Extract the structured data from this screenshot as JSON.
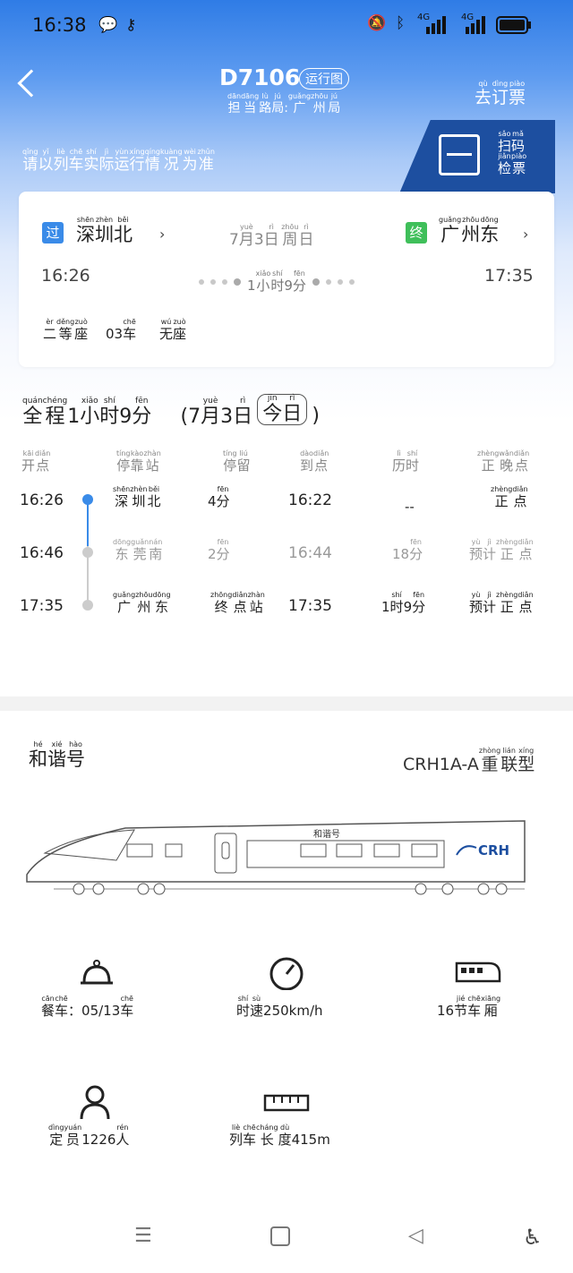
{
  "status_bar": {
    "time": "16:38",
    "network": "4G"
  },
  "header": {
    "train_no": "D7106",
    "timetable_tag": "运行图",
    "bureau": [
      {
        "hz": "担",
        "py": "dān"
      },
      {
        "hz": "当",
        "py": "dāng"
      },
      {
        "hz": "路",
        "py": "lù"
      },
      {
        "hz": "局",
        "py": "jú"
      },
      {
        "hz": ":",
        "py": ""
      },
      {
        "hz": "广",
        "py": "guǎng"
      },
      {
        "hz": "州",
        "py": "zhōu"
      },
      {
        "hz": "局",
        "py": "jú"
      }
    ],
    "buy_ticket": [
      {
        "hz": "去",
        "py": "qù"
      },
      {
        "hz": "订",
        "py": "dìng"
      },
      {
        "hz": "票",
        "py": "piào"
      }
    ],
    "banner_note": [
      {
        "hz": "请",
        "py": "qǐng"
      },
      {
        "hz": "以",
        "py": "yǐ"
      },
      {
        "hz": "列",
        "py": "liè"
      },
      {
        "hz": "车",
        "py": "chē"
      },
      {
        "hz": "实",
        "py": "shí"
      },
      {
        "hz": "际",
        "py": "jì"
      },
      {
        "hz": "运",
        "py": "yùn"
      },
      {
        "hz": "行",
        "py": "xíng"
      },
      {
        "hz": "情",
        "py": "qíng"
      },
      {
        "hz": "况",
        "py": "kuàng"
      },
      {
        "hz": "为",
        "py": "wèi"
      },
      {
        "hz": "准",
        "py": "zhǔn"
      }
    ],
    "scan_check": [
      [
        {
          "hz": "扫",
          "py": "sǎo"
        },
        {
          "hz": "码",
          "py": "mǎ"
        }
      ],
      [
        {
          "hz": "检",
          "py": "jiǎn"
        },
        {
          "hz": "票",
          "py": "piào"
        }
      ]
    ]
  },
  "trip_card": {
    "from_tag": "过",
    "from_station": [
      {
        "hz": "深",
        "py": "shēn"
      },
      {
        "hz": "圳",
        "py": "zhèn"
      },
      {
        "hz": "北",
        "py": "běi"
      }
    ],
    "to_tag": "终",
    "to_station": [
      {
        "hz": "广",
        "py": "guǎng"
      },
      {
        "hz": "州",
        "py": "zhōu"
      },
      {
        "hz": "东",
        "py": "dōng"
      }
    ],
    "date": [
      {
        "hz": "7",
        "py": ""
      },
      {
        "hz": "月",
        "py": "yuè"
      },
      {
        "hz": "3",
        "py": ""
      },
      {
        "hz": "日",
        "py": "rì"
      },
      {
        "hz": " ",
        "py": ""
      },
      {
        "hz": "周",
        "py": "zhōu"
      },
      {
        "hz": "日",
        "py": "rì"
      }
    ],
    "depart_time": "16:26",
    "arrive_time": "17:35",
    "duration": [
      {
        "hz": "1",
        "py": ""
      },
      {
        "hz": "小",
        "py": "xiǎo"
      },
      {
        "hz": "时",
        "py": "shí"
      },
      {
        "hz": "9",
        "py": ""
      },
      {
        "hz": "分",
        "py": "fēn"
      }
    ],
    "seat_class": [
      {
        "hz": "二",
        "py": "èr"
      },
      {
        "hz": "等",
        "py": "děng"
      },
      {
        "hz": "座",
        "py": "zuò"
      }
    ],
    "car": [
      {
        "hz": "03",
        "py": ""
      },
      {
        "hz": "车",
        "py": "chē"
      }
    ],
    "seat": [
      {
        "hz": "无",
        "py": "wú"
      },
      {
        "hz": "座",
        "py": "zuò"
      }
    ]
  },
  "total": {
    "label": [
      {
        "hz": "全",
        "py": "quán"
      },
      {
        "hz": "程",
        "py": "chéng"
      },
      {
        "hz": "1",
        "py": ""
      },
      {
        "hz": "小",
        "py": "xiǎo"
      },
      {
        "hz": "时",
        "py": "shí"
      },
      {
        "hz": "9",
        "py": ""
      },
      {
        "hz": "分",
        "py": "fēn"
      }
    ],
    "date": [
      {
        "hz": "(7",
        "py": ""
      },
      {
        "hz": "月",
        "py": "yuè"
      },
      {
        "hz": "3",
        "py": ""
      },
      {
        "hz": "日",
        "py": "rì"
      }
    ],
    "today": [
      {
        "hz": "今",
        "py": "jīn"
      },
      {
        "hz": "日",
        "py": "rì"
      }
    ],
    "close": ")"
  },
  "schedule": {
    "headers": [
      [
        {
          "hz": "开",
          "py": "kāi"
        },
        {
          "hz": "点",
          "py": "diǎn"
        }
      ],
      [
        {
          "hz": "停",
          "py": "tíng"
        },
        {
          "hz": "靠",
          "py": "kào"
        },
        {
          "hz": "站",
          "py": "zhàn"
        }
      ],
      [
        {
          "hz": "停",
          "py": "tíng"
        },
        {
          "hz": "留",
          "py": "liú"
        }
      ],
      [
        {
          "hz": "到",
          "py": "dào"
        },
        {
          "hz": "点",
          "py": "diǎn"
        }
      ],
      [
        {
          "hz": "历",
          "py": "lì"
        },
        {
          "hz": "时",
          "py": "shí"
        }
      ],
      [
        {
          "hz": "正",
          "py": "zhèng"
        },
        {
          "hz": "晚",
          "py": "wǎn"
        },
        {
          "hz": "点",
          "py": "diǎn"
        }
      ]
    ],
    "rows": [
      {
        "depart": "16:26",
        "station": [
          {
            "hz": "深",
            "py": "shēn"
          },
          {
            "hz": "圳",
            "py": "zhèn"
          },
          {
            "hz": "北",
            "py": "běi"
          }
        ],
        "stop": [
          {
            "hz": "4",
            "py": ""
          },
          {
            "hz": "分",
            "py": "fēn"
          }
        ],
        "arrive": "16:22",
        "elapsed": [
          {
            "hz": "--",
            "py": ""
          }
        ],
        "status": [
          {
            "hz": "正",
            "py": "zhèng"
          },
          {
            "hz": "点",
            "py": "diǎn"
          }
        ]
      },
      {
        "depart": "16:46",
        "station": [
          {
            "hz": "东",
            "py": "dōng"
          },
          {
            "hz": "莞",
            "py": "guǎn"
          },
          {
            "hz": "南",
            "py": "nán"
          }
        ],
        "stop": [
          {
            "hz": "2",
            "py": ""
          },
          {
            "hz": "分",
            "py": "fēn"
          }
        ],
        "arrive": "16:44",
        "elapsed": [
          {
            "hz": "18",
            "py": ""
          },
          {
            "hz": "分",
            "py": "fēn"
          }
        ],
        "status": [
          {
            "hz": "预",
            "py": "yù"
          },
          {
            "hz": "计",
            "py": "jì"
          },
          {
            "hz": "正",
            "py": "zhèng"
          },
          {
            "hz": "点",
            "py": "diǎn"
          }
        ]
      },
      {
        "depart": "17:35",
        "station": [
          {
            "hz": "广",
            "py": "guǎng"
          },
          {
            "hz": "州",
            "py": "zhōu"
          },
          {
            "hz": "东",
            "py": "dōng"
          }
        ],
        "stop": [
          {
            "hz": "终",
            "py": "zhōng"
          },
          {
            "hz": "点",
            "py": "diǎn"
          },
          {
            "hz": "站",
            "py": "zhàn"
          }
        ],
        "arrive": "17:35",
        "elapsed": [
          {
            "hz": "1",
            "py": ""
          },
          {
            "hz": "时",
            "py": "shí"
          },
          {
            "hz": "9",
            "py": ""
          },
          {
            "hz": "分",
            "py": "fēn"
          }
        ],
        "status": [
          {
            "hz": "预",
            "py": "yù"
          },
          {
            "hz": "计",
            "py": "jì"
          },
          {
            "hz": "正",
            "py": "zhèng"
          },
          {
            "hz": "点",
            "py": "diǎn"
          }
        ]
      }
    ]
  },
  "train_info": {
    "brand": [
      {
        "hz": "和",
        "py": "hé"
      },
      {
        "hz": "谐",
        "py": "xié"
      },
      {
        "hz": "号",
        "py": "hào"
      }
    ],
    "model": [
      {
        "hz": "CRH1A-A",
        "py": ""
      },
      {
        "hz": "重",
        "py": "zhòng"
      },
      {
        "hz": "联",
        "py": "lián"
      },
      {
        "hz": "型",
        "py": "xíng"
      }
    ],
    "livery_text": "和谐号",
    "logo_text": "CRH",
    "features": [
      {
        "icon": "dining-bell-icon",
        "text": [
          {
            "hz": "餐",
            "py": "cān"
          },
          {
            "hz": "车",
            "py": "chē"
          },
          {
            "hz": "：05/13",
            "py": ""
          },
          {
            "hz": "车",
            "py": "chē"
          }
        ]
      },
      {
        "icon": "speedometer-icon",
        "text": [
          {
            "hz": "时",
            "py": "shí"
          },
          {
            "hz": "速",
            "py": "sù"
          },
          {
            "hz": "250km/h",
            "py": ""
          }
        ]
      },
      {
        "icon": "train-car-icon",
        "text": [
          {
            "hz": "16",
            "py": ""
          },
          {
            "hz": "节",
            "py": "jié"
          },
          {
            "hz": "车",
            "py": "chē"
          },
          {
            "hz": "厢",
            "py": "xiāng"
          }
        ]
      },
      {
        "icon": "person-icon",
        "text": [
          {
            "hz": "定",
            "py": "dìng"
          },
          {
            "hz": "员",
            "py": "yuán"
          },
          {
            "hz": "1226",
            "py": ""
          },
          {
            "hz": "人",
            "py": "rén"
          }
        ]
      },
      {
        "icon": "ruler-icon",
        "text": [
          {
            "hz": "列",
            "py": "liè"
          },
          {
            "hz": "车",
            "py": "chē"
          },
          {
            "hz": "长",
            "py": "cháng"
          },
          {
            "hz": "度",
            "py": "dù"
          },
          {
            "hz": "415m",
            "py": ""
          }
        ]
      }
    ]
  },
  "colors": {
    "accent": "#2f7ce6",
    "tag_pass": "#3a8be8",
    "tag_end": "#3fbf5a"
  }
}
